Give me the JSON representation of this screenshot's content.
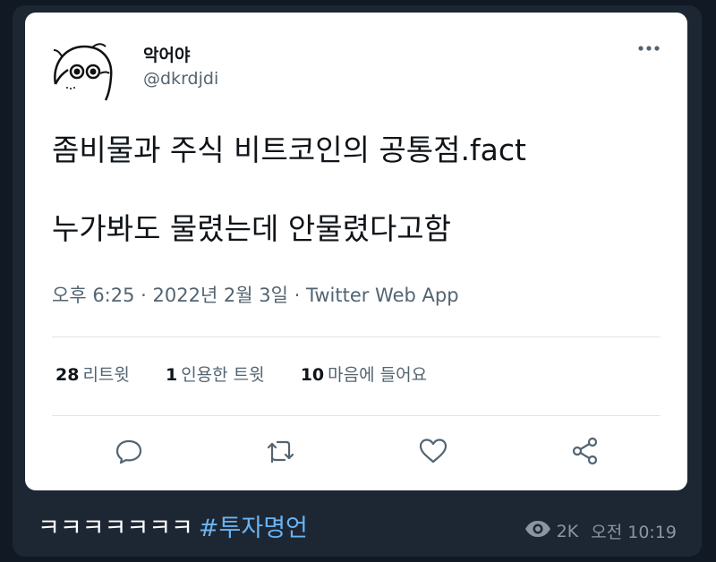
{
  "tweet": {
    "display_name": "악어야",
    "handle": "@dkrdjdi",
    "text_line1": "좀비물과 주식 비트코인의 공통점.fact",
    "text_line2": "누가봐도 물렸는데 안물렸다고함",
    "meta_time": "오후 6:25 · 2022년 2월 3일 · ",
    "meta_app": "Twitter Web App",
    "stats": [
      {
        "count": "28",
        "label": "리트윗"
      },
      {
        "count": "1",
        "label": "인용한 트윗"
      },
      {
        "count": "10",
        "label": "마음에 들어요"
      }
    ],
    "actions": [
      "reply-icon",
      "retweet-icon",
      "like-icon",
      "share-icon"
    ],
    "icons": {
      "more": "more-horizontal-icon"
    }
  },
  "message": {
    "caption_text": "ㅋㅋㅋㅋㅋㅋㅋ",
    "hashtag": "#투자명언",
    "views": "2K",
    "time": "오전 10:19"
  },
  "colors": {
    "background": "#111a24",
    "bubble": "#1d2733",
    "hashtag": "#6ab3f3",
    "secondary_text": "#536471"
  }
}
